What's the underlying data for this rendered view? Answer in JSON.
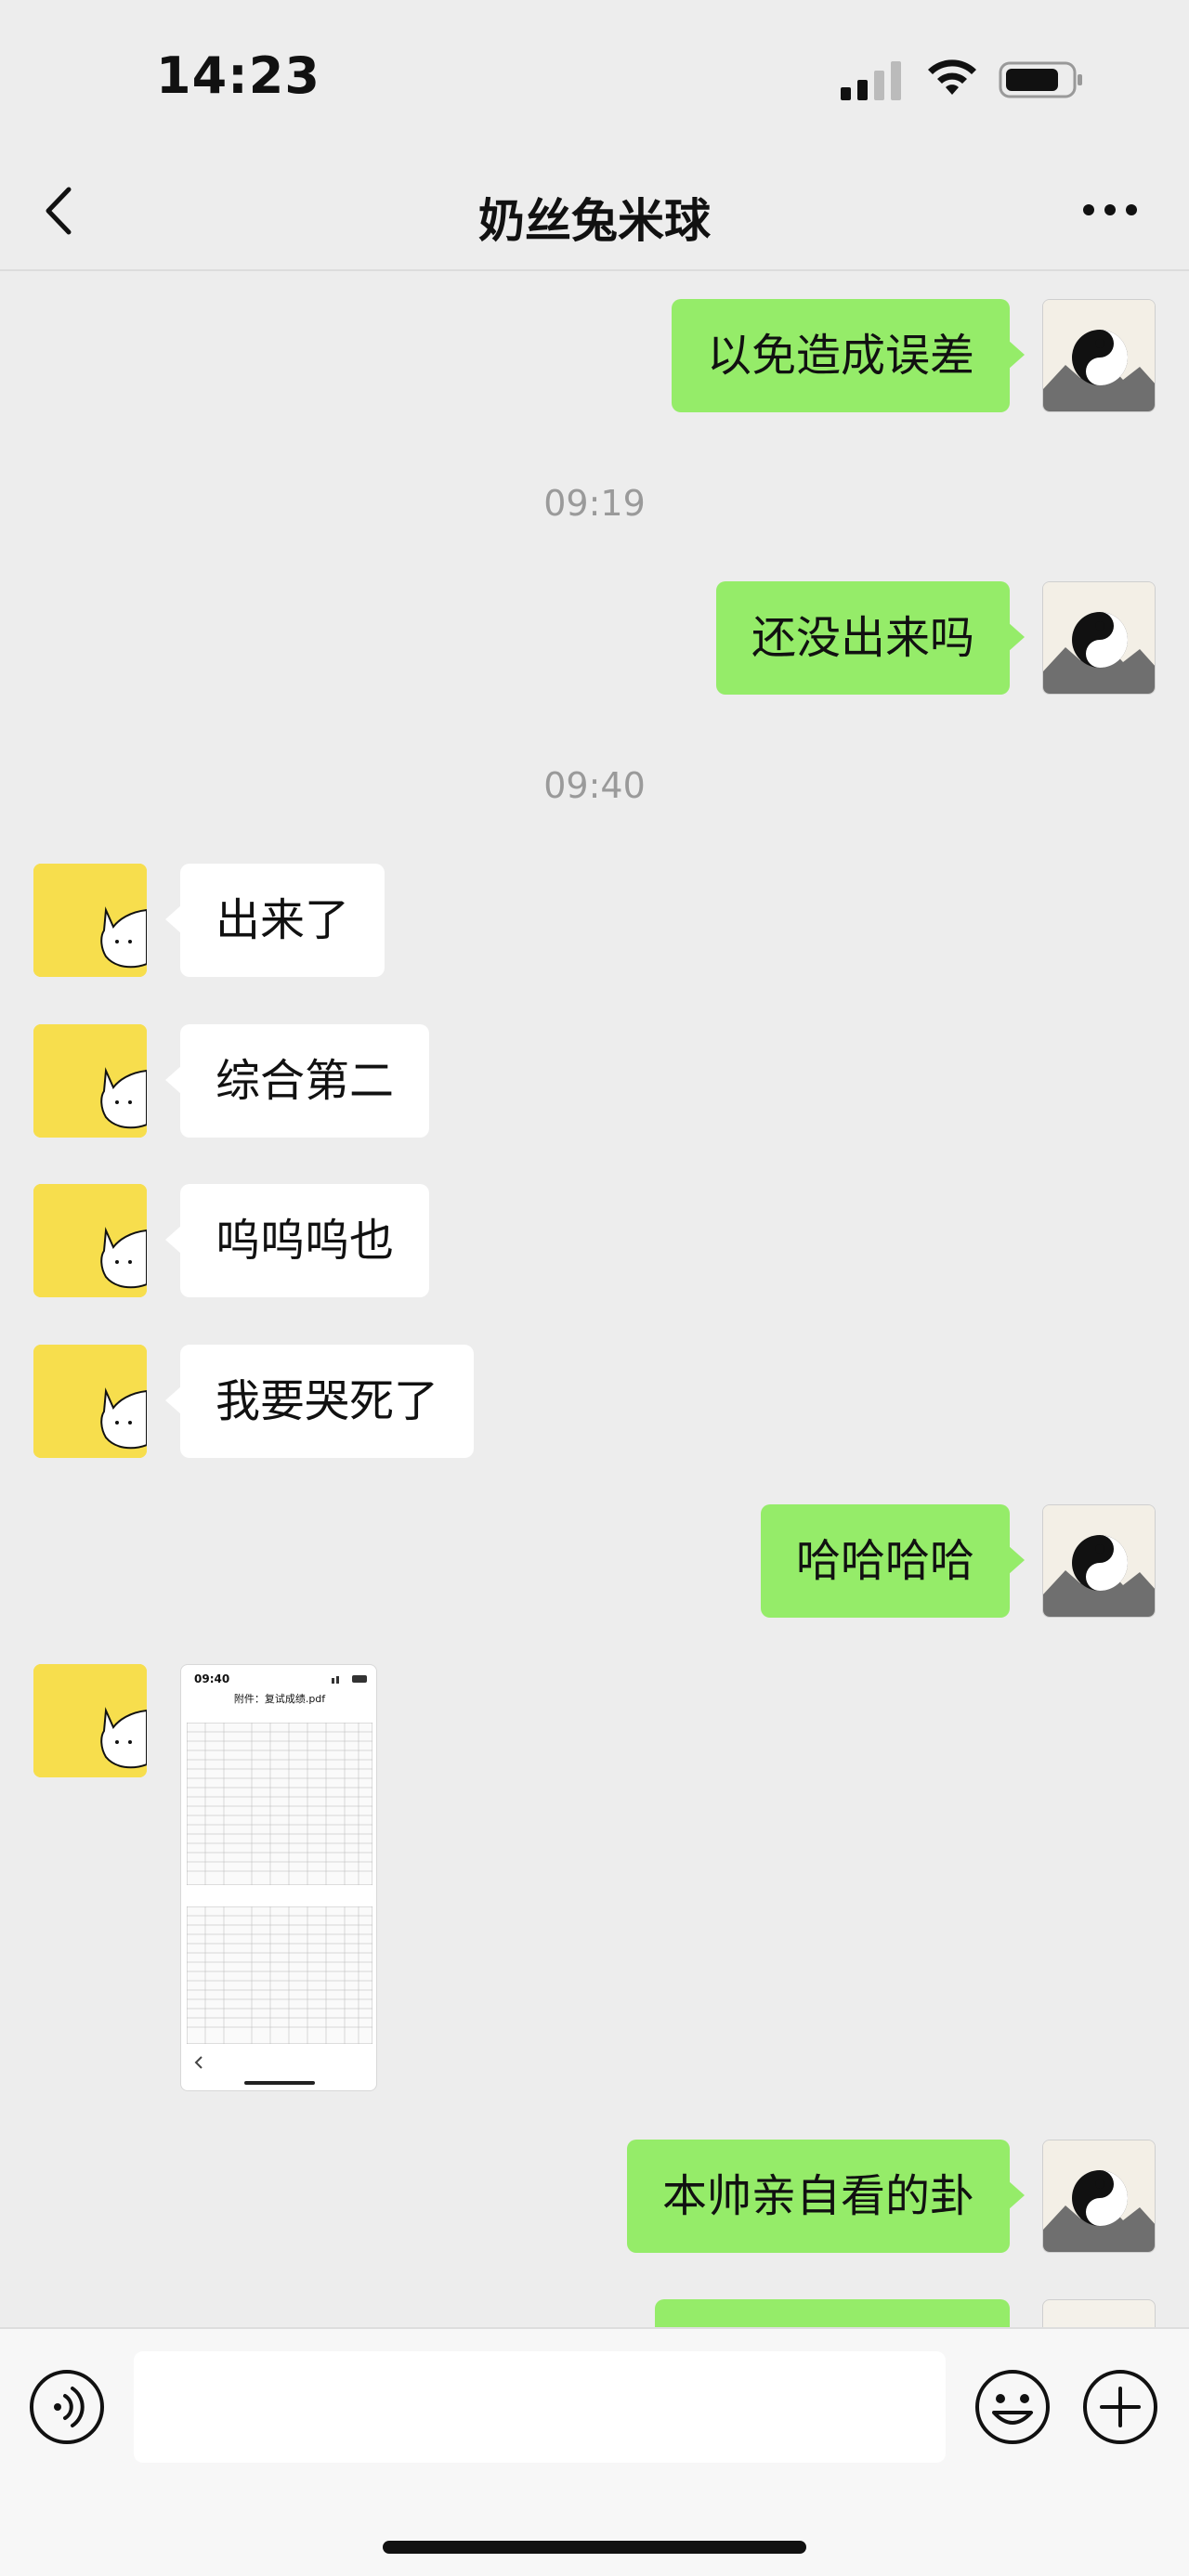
{
  "status_bar": {
    "time": "14:23"
  },
  "nav": {
    "title": "奶丝兔米球"
  },
  "messages": [
    {
      "text": "以免造成误差"
    },
    {
      "text": "还没出来吗"
    },
    {
      "text": "出来了"
    },
    {
      "text": "综合第二"
    },
    {
      "text": "呜呜呜也"
    },
    {
      "text": "我要哭死了"
    },
    {
      "text": "哈哈哈哈"
    },
    {
      "text": "本帅亲自看的卦"
    }
  ],
  "timestamps": [
    "09:19",
    "09:40"
  ],
  "image_message": {
    "time": "09:40",
    "title": "附件：复试成绩.pdf"
  },
  "input": {
    "placeholder": ""
  },
  "colors": {
    "self_bubble": "#95ec69",
    "other_bubble": "#ffffff",
    "background": "#ededed",
    "avatar_other": "#f7de4d"
  },
  "icons": [
    "back-icon",
    "more-icon",
    "voice-icon",
    "emoji-icon",
    "add-icon"
  ]
}
